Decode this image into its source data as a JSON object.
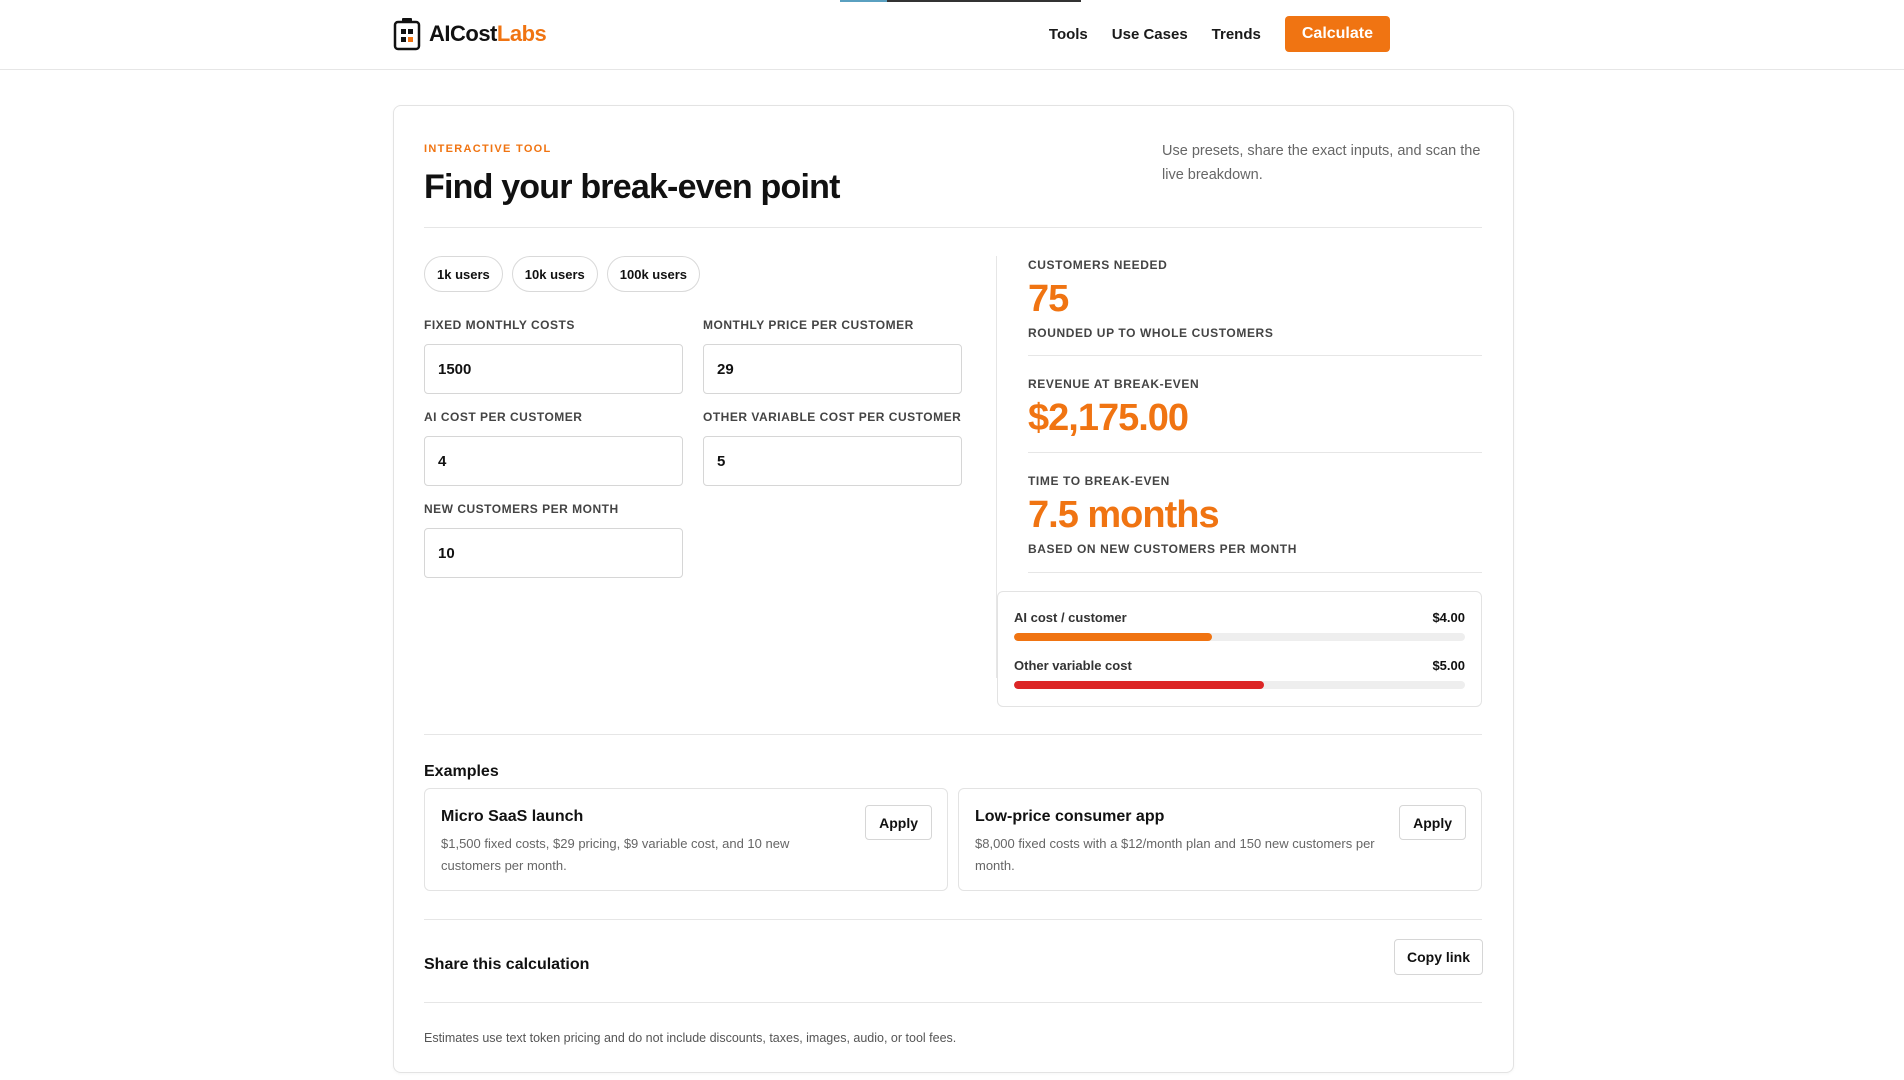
{
  "brand": {
    "name_main": "AICost",
    "name_accent": "Labs"
  },
  "nav": {
    "links": [
      "Tools",
      "Use Cases",
      "Trends"
    ],
    "cta_label": "Calculate"
  },
  "tool": {
    "eyebrow": "INTERACTIVE TOOL",
    "title": "Find your break-even point",
    "subtitle": "Use presets, share the exact inputs, and scan the live breakdown."
  },
  "presets": [
    "1k users",
    "10k users",
    "100k users"
  ],
  "fields": {
    "fixed_monthly_costs": {
      "label": "FIXED MONTHLY COSTS",
      "value": "1500"
    },
    "monthly_price": {
      "label": "MONTHLY PRICE PER CUSTOMER",
      "value": "29"
    },
    "ai_cost": {
      "label": "AI COST PER CUSTOMER",
      "value": "4"
    },
    "other_variable_cost": {
      "label": "OTHER VARIABLE COST PER CUSTOMER",
      "value": "5"
    },
    "new_customers": {
      "label": "NEW CUSTOMERS PER MONTH",
      "value": "10"
    }
  },
  "results": {
    "customers_needed": {
      "label": "CUSTOMERS NEEDED",
      "value": "75",
      "sub": "ROUNDED UP TO WHOLE CUSTOMERS"
    },
    "revenue": {
      "label": "REVENUE AT BREAK-EVEN",
      "value": "$2,175.00"
    },
    "time": {
      "label": "TIME TO BREAK-EVEN",
      "value": "7.5 months",
      "sub": "BASED ON NEW CUSTOMERS PER MONTH"
    }
  },
  "breakdown": [
    {
      "label": "AI cost / customer",
      "amount": "$4.00",
      "fill_fraction": 0.44,
      "color": "#f07412"
    },
    {
      "label": "Other variable cost",
      "amount": "$5.00",
      "fill_fraction": 0.555,
      "color": "#dc2626"
    }
  ],
  "examples": {
    "title": "Examples",
    "items": [
      {
        "title": "Micro SaaS launch",
        "desc": "$1,500 fixed costs, $29 pricing, $9 variable cost, and 10 new customers per month.",
        "button": "Apply"
      },
      {
        "title": "Low-price consumer app",
        "desc": "$8,000 fixed costs with a $12/month plan and 150 new customers per month.",
        "button": "Apply"
      }
    ]
  },
  "share": {
    "title": "Share this calculation",
    "button": "Copy link"
  },
  "footnote": "Estimates use text token pricing and do not include discounts, taxes, images, audio, or tool fees.",
  "colors": {
    "accent": "#f07412",
    "danger": "#dc2626"
  }
}
